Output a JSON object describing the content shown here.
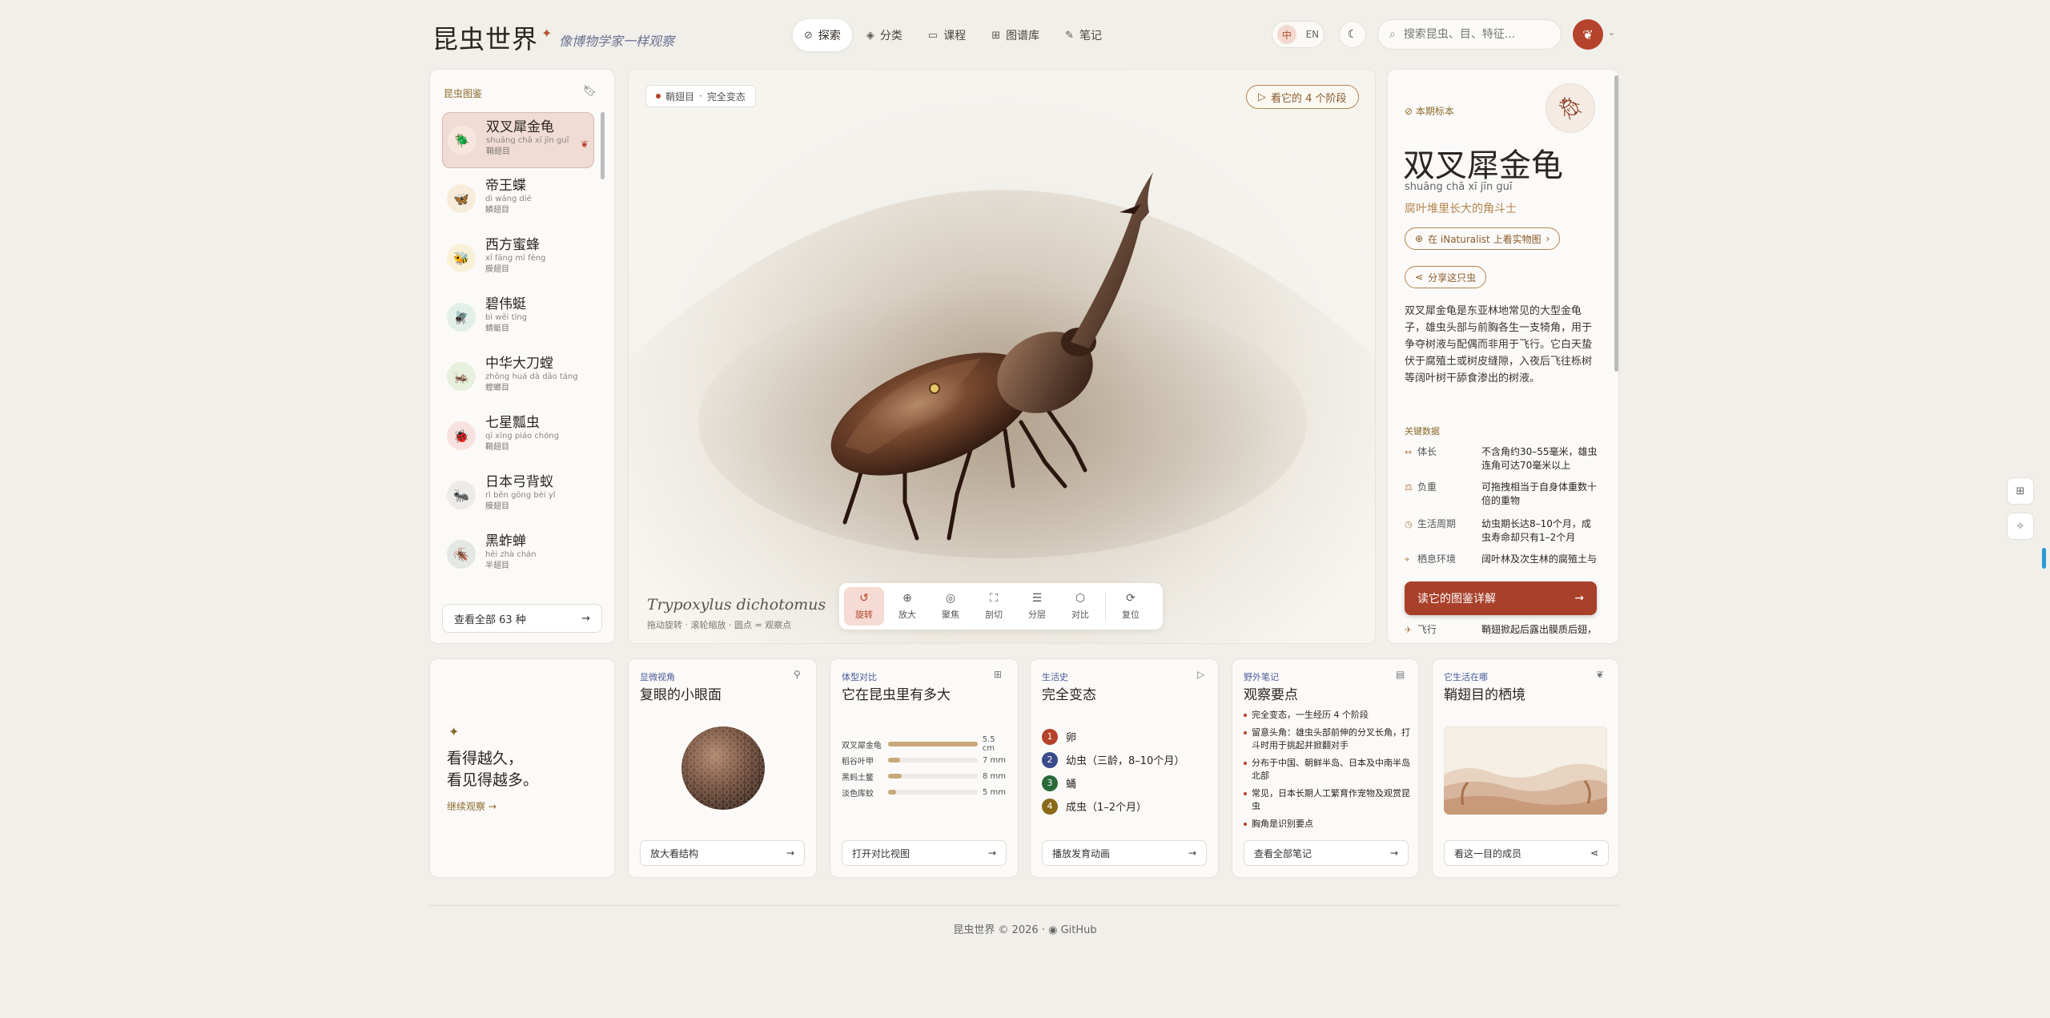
{
  "header": {
    "logo": "昆虫世界",
    "tagline": "像博物学家一样观察",
    "nav": [
      {
        "label": "探索",
        "icon": "compass-icon",
        "active": true
      },
      {
        "label": "分类",
        "icon": "layers-icon"
      },
      {
        "label": "课程",
        "icon": "book-icon"
      },
      {
        "label": "图谱库",
        "icon": "grid-icon"
      },
      {
        "label": "笔记",
        "icon": "pen-icon"
      }
    ],
    "lang": {
      "zh": "中",
      "en": "EN"
    },
    "search_placeholder": "搜索昆虫、目、特征..."
  },
  "sidebar": {
    "title": "昆虫图鉴",
    "items": [
      {
        "name": "双叉犀金龟",
        "pinyin": "shuāng chā xī jīn guī",
        "order": "鞘翅目",
        "glyph": "🪲",
        "bg": "#f6e6de",
        "active": true
      },
      {
        "name": "帝王蝶",
        "pinyin": "dì wáng dié",
        "order": "鳞翅目",
        "glyph": "🦋",
        "bg": "#f8ecda"
      },
      {
        "name": "西方蜜蜂",
        "pinyin": "xī fāng mì fēng",
        "order": "膜翅目",
        "glyph": "🐝",
        "bg": "#f8f1d8"
      },
      {
        "name": "碧伟蜓",
        "pinyin": "bì wěi tíng",
        "order": "蜻蜓目",
        "glyph": "🪰",
        "bg": "#e3f0ea"
      },
      {
        "name": "中华大刀螳",
        "pinyin": "zhōng huá dà dāo táng",
        "order": "螳螂目",
        "glyph": "🦗",
        "bg": "#e6f0dc"
      },
      {
        "name": "七星瓢虫",
        "pinyin": "qī xīng piáo chóng",
        "order": "鞘翅目",
        "glyph": "🐞",
        "bg": "#f8e2e0"
      },
      {
        "name": "日本弓背蚁",
        "pinyin": "rì běn gōng bèi yǐ",
        "order": "膜翅目",
        "glyph": "🐜",
        "bg": "#ecebe8"
      },
      {
        "name": "黑蚱蝉",
        "pinyin": "hēi zhà chán",
        "order": "半翅目",
        "glyph": "🪳",
        "bg": "#e4e8e4"
      }
    ],
    "view_all": "查看全部 63 种"
  },
  "viewer": {
    "badge_order": "鞘翅目",
    "badge_meta": "完全变态",
    "stages_button": "看它的 4 个阶段",
    "scientific_name": "Trypoxylus dichotomus",
    "hint": "拖动旋转 · 滚轮缩放 · 圆点 = 观察点",
    "tools": [
      {
        "label": "旋转",
        "icon": "↺",
        "active": true
      },
      {
        "label": "放大",
        "icon": "⊕"
      },
      {
        "label": "聚焦",
        "icon": "◎"
      },
      {
        "label": "剖切",
        "icon": "⛶"
      },
      {
        "label": "分层",
        "icon": "☰"
      },
      {
        "label": "对比",
        "icon": "⬡"
      },
      {
        "label": "复位",
        "icon": "⟳"
      }
    ]
  },
  "specimen": {
    "label": "本期标本",
    "name": "双叉犀金龟",
    "pinyin": "shuāng chā xī jīn guī",
    "subtitle": "腐叶堆里长大的角斗士",
    "inat_button": "在 iNaturalist 上看实物图",
    "share_button": "分享这只虫",
    "description": "双叉犀金龟是东亚林地常见的大型金龟子，雄虫头部与前胸各生一支犄角，用于争夺树液与配偶而非用于飞行。它白天蛰伏于腐殖土或树皮缝隙，入夜后飞往栎树等阔叶树干舔食渗出的树液。",
    "key_title": "关键数据",
    "facts": [
      {
        "icon": "↔",
        "key": "体长",
        "value": "不含角约30–55毫米，雄虫连角可达70毫米以上"
      },
      {
        "icon": "⚖",
        "key": "负重",
        "value": "可拖拽相当于自身体重数十倍的重物"
      },
      {
        "icon": "◷",
        "key": "生活周期",
        "value": "幼虫期长达8–10个月，成虫寿命却只有1–2个月"
      },
      {
        "icon": "⌖",
        "key": "栖息环境",
        "value": "阔叶林及次生林的腐殖土与"
      },
      {
        "icon": "✈",
        "key": "飞行",
        "value": "鞘翅掀起后露出膜质后翅，"
      }
    ],
    "cta": "读它的图鉴详解"
  },
  "quote": {
    "line1": "看得越久，",
    "line2": "看见得越多。",
    "link": "继续观察 →"
  },
  "cards": {
    "eye": {
      "tag": "显微视角",
      "title": "复眼的小眼面",
      "button": "放大看结构"
    },
    "size": {
      "tag": "体型对比",
      "title": "它在昆虫里有多大",
      "button": "打开对比视图",
      "rows": [
        {
          "label": "双叉犀金龟",
          "value": "5.5 cm",
          "fill": 1.0
        },
        {
          "label": "稻谷叶甲",
          "value": "7 mm",
          "fill": 0.13
        },
        {
          "label": "黑蚂土鳖",
          "value": "8 mm",
          "fill": 0.15
        },
        {
          "label": "淡色库蚊",
          "value": "5 mm",
          "fill": 0.09
        }
      ]
    },
    "life": {
      "tag": "生活史",
      "title": "完全变态",
      "button": "播放发育动画",
      "stages": [
        {
          "n": "1",
          "label": "卵",
          "color": "#b5422a"
        },
        {
          "n": "2",
          "label": "幼虫（三龄，8–10个月）",
          "color": "#3a4a8a"
        },
        {
          "n": "3",
          "label": "蛹",
          "color": "#2a6a3a"
        },
        {
          "n": "4",
          "label": "成虫（1–2个月）",
          "color": "#8a6a1a"
        }
      ]
    },
    "notes": {
      "tag": "野外笔记",
      "title": "观察要点",
      "button": "查看全部笔记",
      "items": [
        "完全变态，一生经历 4 个阶段",
        "留意头角：雄虫头部前伸的分叉长角，打斗时用于挑起并掀翻对手",
        "分布于中国、朝鲜半岛、日本及中南半岛北部",
        "常见，日本长期人工繁育作宠物及观赏昆虫",
        "胸角是识别要点"
      ]
    },
    "habitat": {
      "tag": "它生活在哪",
      "title": "鞘翅目的栖境",
      "button": "看这一目的成员"
    }
  },
  "footer": {
    "copyright": "昆虫世界 © 2026",
    "github": "GitHub"
  }
}
